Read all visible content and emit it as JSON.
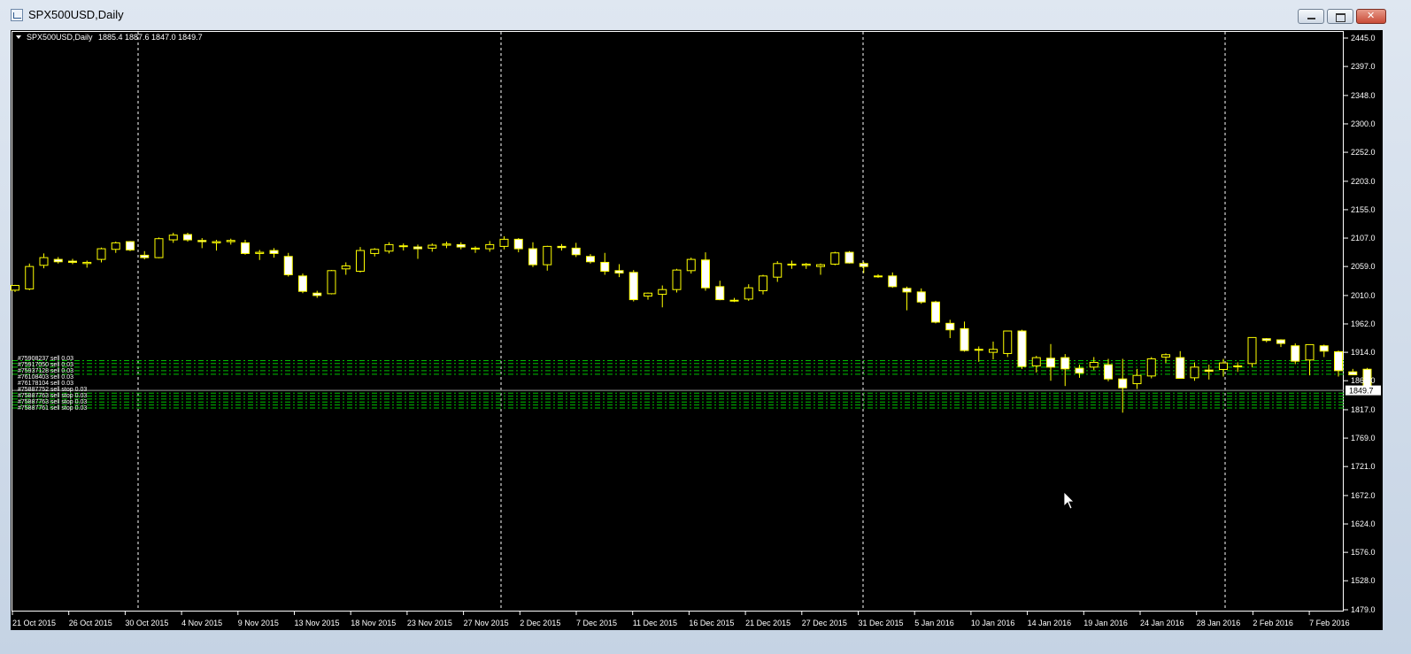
{
  "window": {
    "title": "SPX500USD,Daily"
  },
  "chart_header": {
    "symbol": "SPX500USD,Daily",
    "ohlc": "1885.4 1887.6 1847.0 1849.7"
  },
  "current_price": "1849.7",
  "colors": {
    "background": "#000000",
    "candle": "#ffff00",
    "bull_body": "#000000",
    "bear_body": "#ffffff",
    "grid": "#ffffff",
    "order_lines": "#00c000",
    "axis": "#ffffff"
  },
  "y_ticks": [
    "2445.0",
    "2397.0",
    "2348.0",
    "2300.0",
    "2252.0",
    "2203.0",
    "2155.0",
    "2107.0",
    "2059.0",
    "2010.0",
    "1962.0",
    "1914.0",
    "1866.0",
    "1817.0",
    "1769.0",
    "1721.0",
    "1672.0",
    "1624.0",
    "1576.0",
    "1528.0",
    "1479.0"
  ],
  "x_ticks": [
    "21 Oct 2015",
    "26 Oct 2015",
    "30 Oct 2015",
    "4 Nov 2015",
    "9 Nov 2015",
    "13 Nov 2015",
    "18 Nov 2015",
    "23 Nov 2015",
    "27 Nov 2015",
    "2 Dec 2015",
    "7 Dec 2015",
    "11 Dec 2015",
    "16 Dec 2015",
    "21 Dec 2015",
    "27 Dec 2015",
    "31 Dec 2015",
    "5 Jan 2016",
    "10 Jan 2016",
    "14 Jan 2016",
    "19 Jan 2016",
    "24 Jan 2016",
    "28 Jan 2016",
    "2 Feb 2016",
    "7 Feb 2016"
  ],
  "order_labels": [
    "#75908237 sell 0.03",
    "#75917050 sell 0.03",
    "#75937128 sell 0.03",
    "#76108403 sell 0.03",
    "#76178104 sell 0.03",
    "#75887752 sell stop 0.03",
    "#75887763 sell stop 0.03",
    "#75887763 sell stop 0.03",
    "#75887761 sell stop 0.03"
  ],
  "chart_data": {
    "type": "candlestick",
    "ylim": [
      1479.0,
      2445.0
    ],
    "x_labels": [
      "21 Oct 2015",
      "26 Oct 2015",
      "30 Oct 2015",
      "4 Nov 2015",
      "9 Nov 2015",
      "13 Nov 2015",
      "18 Nov 2015",
      "23 Nov 2015",
      "27 Nov 2015",
      "2 Dec 2015",
      "7 Dec 2015",
      "11 Dec 2015",
      "16 Dec 2015",
      "21 Dec 2015",
      "27 Dec 2015",
      "31 Dec 2015",
      "5 Jan 2016",
      "10 Jan 2016",
      "14 Jan 2016",
      "19 Jan 2016",
      "24 Jan 2016",
      "28 Jan 2016",
      "2 Feb 2016",
      "7 Feb 2016"
    ],
    "candles": [
      {
        "o": 2019,
        "h": 2028,
        "l": 2016,
        "c": 2027
      },
      {
        "o": 2021,
        "h": 2064,
        "l": 2019,
        "c": 2059
      },
      {
        "o": 2061,
        "h": 2081,
        "l": 2056,
        "c": 2074
      },
      {
        "o": 2071,
        "h": 2075,
        "l": 2064,
        "c": 2067
      },
      {
        "o": 2068,
        "h": 2072,
        "l": 2063,
        "c": 2066
      },
      {
        "o": 2064,
        "h": 2069,
        "l": 2057,
        "c": 2066
      },
      {
        "o": 2071,
        "h": 2091,
        "l": 2066,
        "c": 2089
      },
      {
        "o": 2088,
        "h": 2101,
        "l": 2082,
        "c": 2099
      },
      {
        "o": 2101,
        "h": 2102,
        "l": 2085,
        "c": 2087
      },
      {
        "o": 2078,
        "h": 2085,
        "l": 2071,
        "c": 2074
      },
      {
        "o": 2074,
        "h": 2108,
        "l": 2073,
        "c": 2106
      },
      {
        "o": 2104,
        "h": 2116,
        "l": 2099,
        "c": 2112
      },
      {
        "o": 2113,
        "h": 2116,
        "l": 2101,
        "c": 2104
      },
      {
        "o": 2103,
        "h": 2107,
        "l": 2090,
        "c": 2101
      },
      {
        "o": 2099,
        "h": 2104,
        "l": 2086,
        "c": 2101
      },
      {
        "o": 2101,
        "h": 2106,
        "l": 2096,
        "c": 2103
      },
      {
        "o": 2099,
        "h": 2104,
        "l": 2079,
        "c": 2081
      },
      {
        "o": 2081,
        "h": 2087,
        "l": 2070,
        "c": 2083
      },
      {
        "o": 2086,
        "h": 2090,
        "l": 2074,
        "c": 2081
      },
      {
        "o": 2076,
        "h": 2082,
        "l": 2042,
        "c": 2045
      },
      {
        "o": 2043,
        "h": 2047,
        "l": 2014,
        "c": 2017
      },
      {
        "o": 2014,
        "h": 2018,
        "l": 2006,
        "c": 2010
      },
      {
        "o": 2013,
        "h": 2053,
        "l": 2012,
        "c": 2052
      },
      {
        "o": 2055,
        "h": 2066,
        "l": 2045,
        "c": 2060
      },
      {
        "o": 2051,
        "h": 2092,
        "l": 2049,
        "c": 2086
      },
      {
        "o": 2081,
        "h": 2090,
        "l": 2076,
        "c": 2088
      },
      {
        "o": 2085,
        "h": 2100,
        "l": 2081,
        "c": 2096
      },
      {
        "o": 2094,
        "h": 2098,
        "l": 2086,
        "c": 2093
      },
      {
        "o": 2092,
        "h": 2096,
        "l": 2072,
        "c": 2089
      },
      {
        "o": 2090,
        "h": 2098,
        "l": 2084,
        "c": 2095
      },
      {
        "o": 2095,
        "h": 2101,
        "l": 2090,
        "c": 2097
      },
      {
        "o": 2096,
        "h": 2100,
        "l": 2088,
        "c": 2092
      },
      {
        "o": 2089,
        "h": 2093,
        "l": 2082,
        "c": 2090
      },
      {
        "o": 2089,
        "h": 2102,
        "l": 2084,
        "c": 2096
      },
      {
        "o": 2093,
        "h": 2110,
        "l": 2088,
        "c": 2105
      },
      {
        "o": 2105,
        "h": 2107,
        "l": 2083,
        "c": 2089
      },
      {
        "o": 2089,
        "h": 2100,
        "l": 2058,
        "c": 2062
      },
      {
        "o": 2062,
        "h": 2094,
        "l": 2052,
        "c": 2093
      },
      {
        "o": 2093,
        "h": 2097,
        "l": 2086,
        "c": 2091
      },
      {
        "o": 2090,
        "h": 2099,
        "l": 2075,
        "c": 2079
      },
      {
        "o": 2076,
        "h": 2080,
        "l": 2064,
        "c": 2067
      },
      {
        "o": 2066,
        "h": 2082,
        "l": 2045,
        "c": 2051
      },
      {
        "o": 2052,
        "h": 2063,
        "l": 2041,
        "c": 2048
      },
      {
        "o": 2049,
        "h": 2053,
        "l": 2000,
        "c": 2003
      },
      {
        "o": 2009,
        "h": 2015,
        "l": 2003,
        "c": 2014
      },
      {
        "o": 2012,
        "h": 2027,
        "l": 1990,
        "c": 2020
      },
      {
        "o": 2020,
        "h": 2055,
        "l": 2015,
        "c": 2053
      },
      {
        "o": 2052,
        "h": 2074,
        "l": 2047,
        "c": 2071
      },
      {
        "o": 2070,
        "h": 2083,
        "l": 2018,
        "c": 2023
      },
      {
        "o": 2025,
        "h": 2035,
        "l": 2002,
        "c": 2003
      },
      {
        "o": 2002,
        "h": 2006,
        "l": 1999,
        "c": 2001
      },
      {
        "o": 2004,
        "h": 2029,
        "l": 2001,
        "c": 2023
      },
      {
        "o": 2018,
        "h": 2045,
        "l": 2012,
        "c": 2043
      },
      {
        "o": 2041,
        "h": 2068,
        "l": 2033,
        "c": 2064
      },
      {
        "o": 2063,
        "h": 2069,
        "l": 2055,
        "c": 2063
      },
      {
        "o": 2061,
        "h": 2065,
        "l": 2055,
        "c": 2063
      },
      {
        "o": 2059,
        "h": 2064,
        "l": 2045,
        "c": 2062
      },
      {
        "o": 2063,
        "h": 2084,
        "l": 2061,
        "c": 2082
      },
      {
        "o": 2083,
        "h": 2085,
        "l": 2064,
        "c": 2065
      },
      {
        "o": 2064,
        "h": 2067,
        "l": 2048,
        "c": 2059
      },
      {
        "o": 2043,
        "h": 2046,
        "l": 2040,
        "c": 2043
      },
      {
        "o": 2043,
        "h": 2049,
        "l": 2023,
        "c": 2025
      },
      {
        "o": 2022,
        "h": 2025,
        "l": 1985,
        "c": 2016
      },
      {
        "o": 2016,
        "h": 2022,
        "l": 1996,
        "c": 1999
      },
      {
        "o": 1999,
        "h": 2001,
        "l": 1963,
        "c": 1965
      },
      {
        "o": 1963,
        "h": 1969,
        "l": 1938,
        "c": 1952
      },
      {
        "o": 1954,
        "h": 1966,
        "l": 1915,
        "c": 1917
      },
      {
        "o": 1918,
        "h": 1924,
        "l": 1898,
        "c": 1919
      },
      {
        "o": 1914,
        "h": 1932,
        "l": 1902,
        "c": 1919
      },
      {
        "o": 1912,
        "h": 1950,
        "l": 1906,
        "c": 1950
      },
      {
        "o": 1950,
        "h": 1952,
        "l": 1886,
        "c": 1890
      },
      {
        "o": 1891,
        "h": 1908,
        "l": 1880,
        "c": 1905
      },
      {
        "o": 1904,
        "h": 1928,
        "l": 1866,
        "c": 1889
      },
      {
        "o": 1905,
        "h": 1911,
        "l": 1857,
        "c": 1886
      },
      {
        "o": 1887,
        "h": 1893,
        "l": 1871,
        "c": 1879
      },
      {
        "o": 1889,
        "h": 1906,
        "l": 1884,
        "c": 1897
      },
      {
        "o": 1893,
        "h": 1903,
        "l": 1865,
        "c": 1869
      },
      {
        "o": 1869,
        "h": 1903,
        "l": 1812,
        "c": 1854
      },
      {
        "o": 1861,
        "h": 1886,
        "l": 1852,
        "c": 1875
      },
      {
        "o": 1874,
        "h": 1906,
        "l": 1870,
        "c": 1903
      },
      {
        "o": 1906,
        "h": 1912,
        "l": 1896,
        "c": 1910
      },
      {
        "o": 1905,
        "h": 1916,
        "l": 1870,
        "c": 1870
      },
      {
        "o": 1871,
        "h": 1897,
        "l": 1866,
        "c": 1889
      },
      {
        "o": 1884,
        "h": 1893,
        "l": 1868,
        "c": 1882
      },
      {
        "o": 1885,
        "h": 1903,
        "l": 1873,
        "c": 1896
      },
      {
        "o": 1891,
        "h": 1897,
        "l": 1881,
        "c": 1891
      },
      {
        "o": 1895,
        "h": 1938,
        "l": 1889,
        "c": 1939
      },
      {
        "o": 1937,
        "h": 1938,
        "l": 1931,
        "c": 1934
      },
      {
        "o": 1935,
        "h": 1936,
        "l": 1923,
        "c": 1929
      },
      {
        "o": 1925,
        "h": 1929,
        "l": 1894,
        "c": 1899
      },
      {
        "o": 1901,
        "h": 1927,
        "l": 1875,
        "c": 1927
      },
      {
        "o": 1925,
        "h": 1927,
        "l": 1906,
        "c": 1916
      },
      {
        "o": 1915,
        "h": 1917,
        "l": 1873,
        "c": 1883
      },
      {
        "o": 1881,
        "h": 1886,
        "l": 1877,
        "c": 1876
      },
      {
        "o": 1885.4,
        "h": 1887.6,
        "l": 1847.0,
        "c": 1849.7
      }
    ]
  }
}
